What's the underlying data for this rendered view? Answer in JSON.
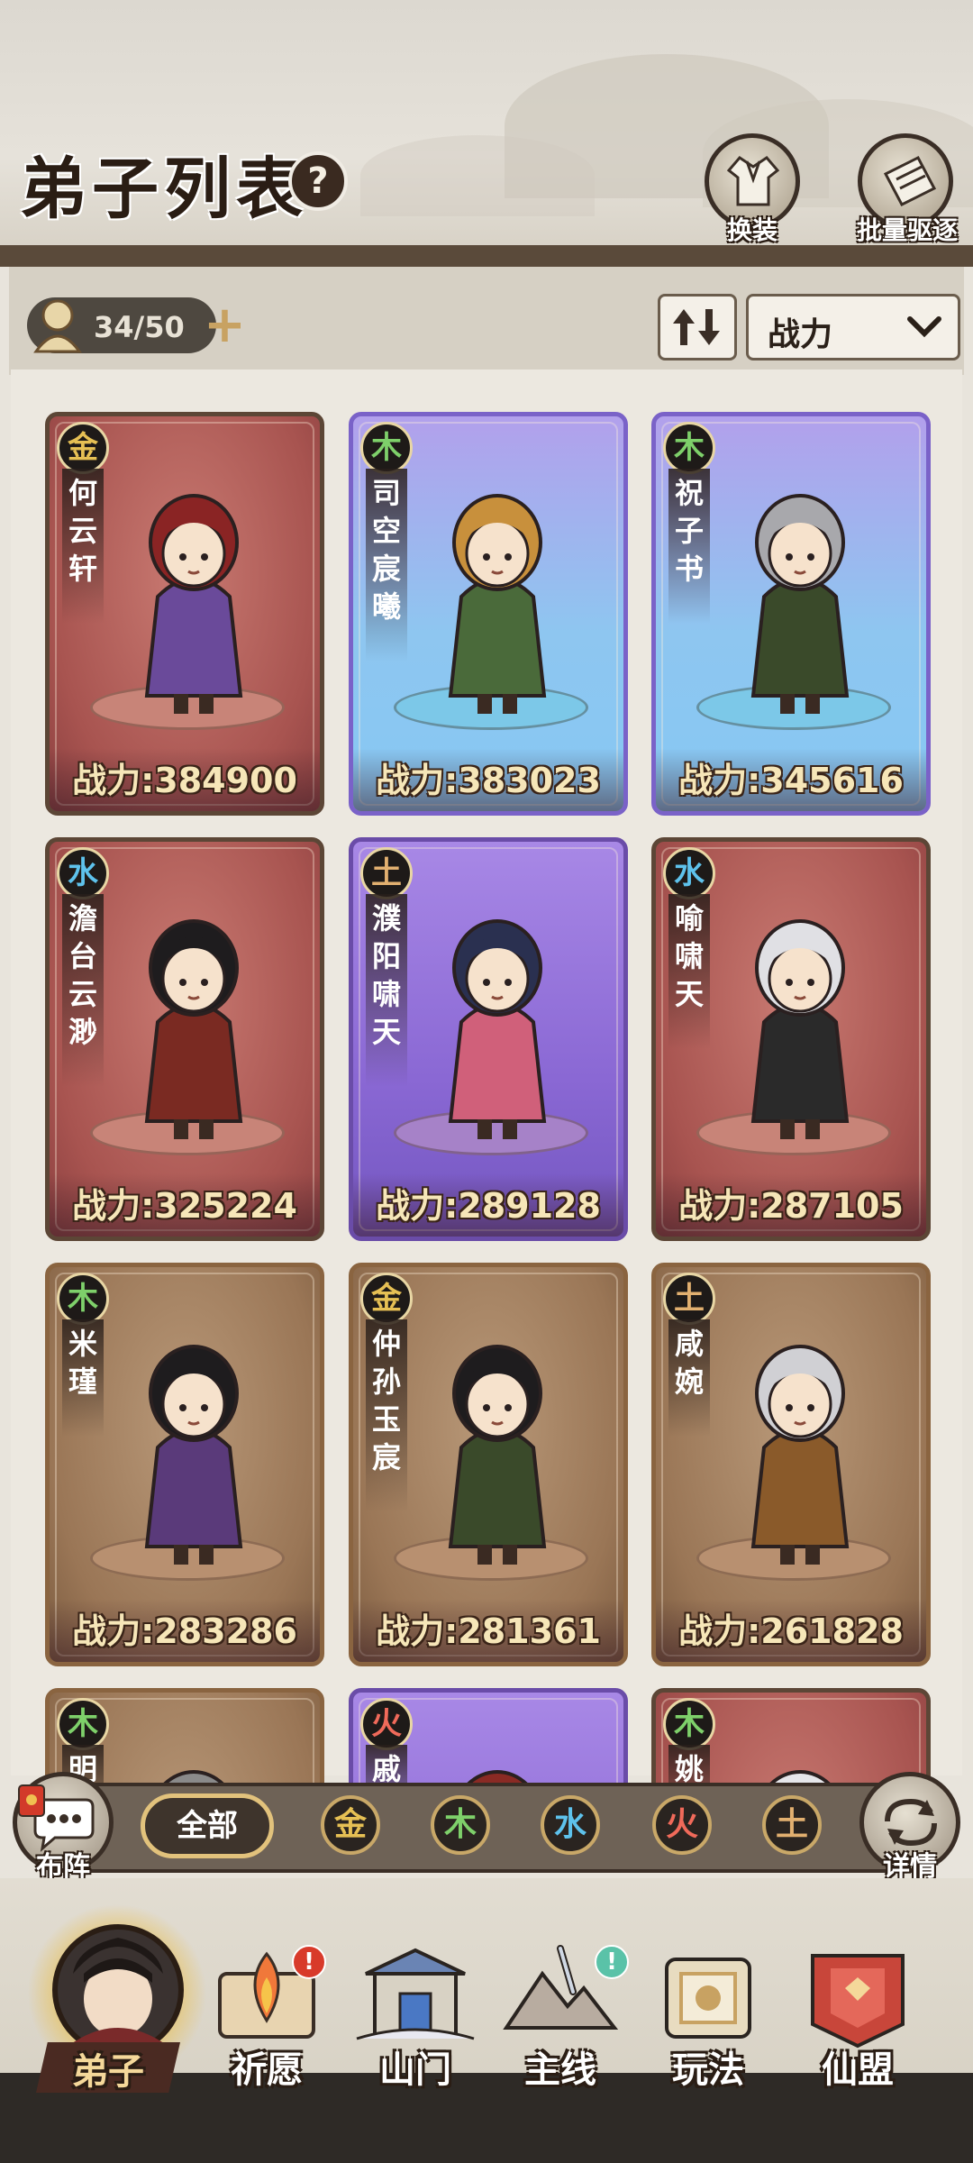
{
  "header": {
    "title": "弟子列表",
    "help_icon": "?",
    "buttons": [
      {
        "label": "换装",
        "icon": "outfit-icon"
      },
      {
        "label": "批量驱逐",
        "icon": "dismiss-icon"
      }
    ]
  },
  "toolbar": {
    "count": "34/50",
    "sort_icon": "sort-arrows-icon",
    "sort_selected": "战力"
  },
  "cards": [
    {
      "element": "金",
      "element_color": "#e6c054",
      "name": [
        "何",
        "云",
        "轩"
      ],
      "power": "战力:384900",
      "theme": "red"
    },
    {
      "element": "木",
      "element_color": "#7ed06a",
      "name": [
        "司",
        "空",
        "宸",
        "曦"
      ],
      "power": "战力:383023",
      "theme": "blue"
    },
    {
      "element": "木",
      "element_color": "#7ed06a",
      "name": [
        "祝",
        "子",
        "书"
      ],
      "power": "战力:345616",
      "theme": "blue"
    },
    {
      "element": "水",
      "element_color": "#5ec2ec",
      "name": [
        "澹",
        "台",
        "云",
        "渺"
      ],
      "power": "战力:325224",
      "theme": "red"
    },
    {
      "element": "土",
      "element_color": "#e2b070",
      "name": [
        "濮",
        "阳",
        "啸",
        "天"
      ],
      "power": "战力:289128",
      "theme": "purple"
    },
    {
      "element": "水",
      "element_color": "#5ec2ec",
      "name": [
        "喻",
        "啸",
        "天"
      ],
      "power": "战力:287105",
      "theme": "red"
    },
    {
      "element": "木",
      "element_color": "#7ed06a",
      "name": [
        "米",
        "瑾"
      ],
      "power": "战力:283286",
      "theme": "brown"
    },
    {
      "element": "金",
      "element_color": "#e6c054",
      "name": [
        "仲",
        "孙",
        "玉",
        "宸"
      ],
      "power": "战力:281361",
      "theme": "brown"
    },
    {
      "element": "土",
      "element_color": "#e2b070",
      "name": [
        "咸",
        "婉"
      ],
      "power": "战力:261828",
      "theme": "brown"
    },
    {
      "element": "木",
      "element_color": "#7ed06a",
      "name": [
        "明"
      ],
      "power": "",
      "theme": "brown"
    },
    {
      "element": "火",
      "element_color": "#f06a5a",
      "name": [
        "戚"
      ],
      "power": "",
      "theme": "purple"
    },
    {
      "element": "木",
      "element_color": "#7ed06a",
      "name": [
        "姚"
      ],
      "power": "",
      "theme": "red"
    }
  ],
  "filters": {
    "all": "全部",
    "elements": [
      {
        "label": "金",
        "color": "#e6c054"
      },
      {
        "label": "木",
        "color": "#7ed06a"
      },
      {
        "label": "水",
        "color": "#5ec2ec"
      },
      {
        "label": "火",
        "color": "#f06a5a"
      },
      {
        "label": "土",
        "color": "#e2b070"
      }
    ],
    "left_button": "布阵",
    "right_button": "详情"
  },
  "nav": [
    {
      "label": "弟子",
      "icon": "disciple-icon",
      "active": true
    },
    {
      "label": "祈愿",
      "icon": "wish-scroll-icon",
      "badge": "!"
    },
    {
      "label": "山门",
      "icon": "gate-icon"
    },
    {
      "label": "主线",
      "icon": "mainline-icon",
      "badge": "!"
    },
    {
      "label": "玩法",
      "icon": "gameplay-icon"
    },
    {
      "label": "仙盟",
      "icon": "alliance-icon"
    }
  ]
}
